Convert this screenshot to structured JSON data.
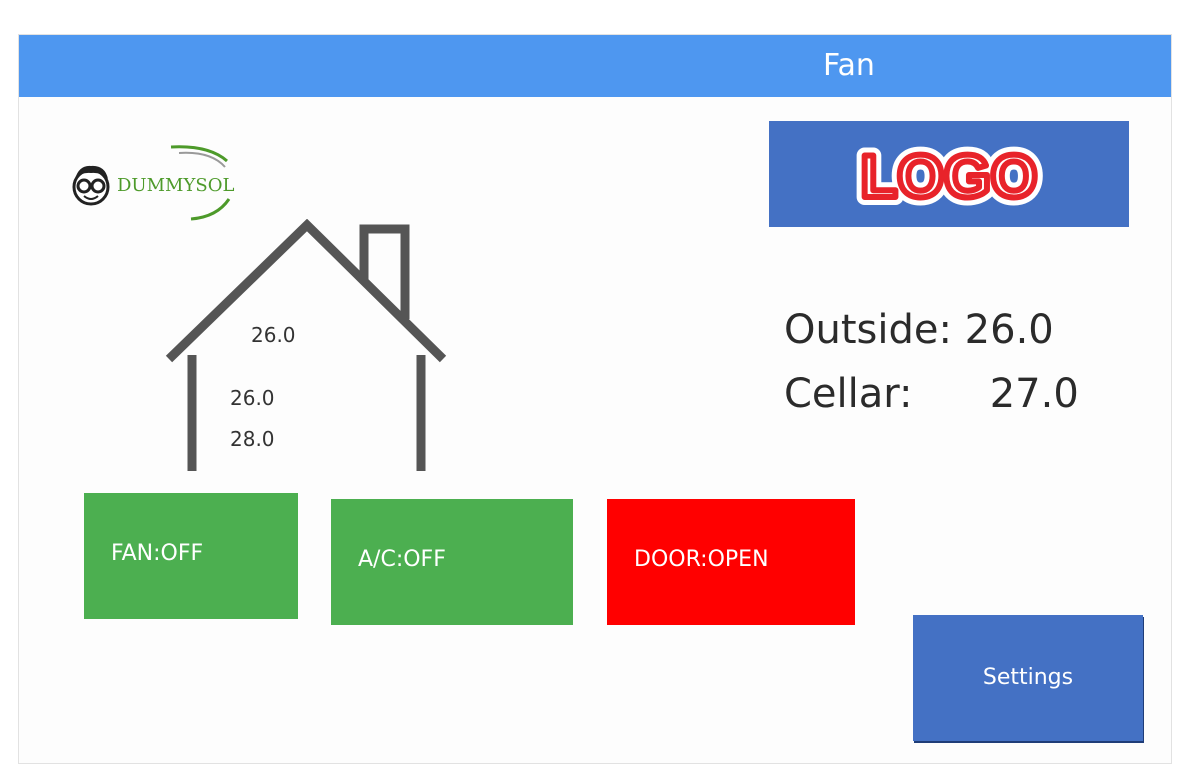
{
  "window": {
    "title": "Fan"
  },
  "brand": {
    "name_first": "DUMMY",
    "name_last": "SOL"
  },
  "logo": {
    "text": "LOGO"
  },
  "house": {
    "reading_top": "26.0",
    "reading_mid": "26.0",
    "reading_low": "28.0"
  },
  "readings": {
    "outside_label": "Outside:",
    "outside_value": "26.0",
    "cellar_label": "Cellar:",
    "cellar_value": "27.0"
  },
  "controls": {
    "fan_label": "FAN:OFF",
    "ac_label": "A/C:OFF",
    "door_label": "DOOR:OPEN"
  },
  "settings": {
    "label": "Settings"
  },
  "colors": {
    "titlebar": "#4e97f0",
    "on_green": "#4caf50",
    "alert_red": "#ff0000",
    "button_blue": "#4471c4",
    "house_stroke": "#555555"
  }
}
